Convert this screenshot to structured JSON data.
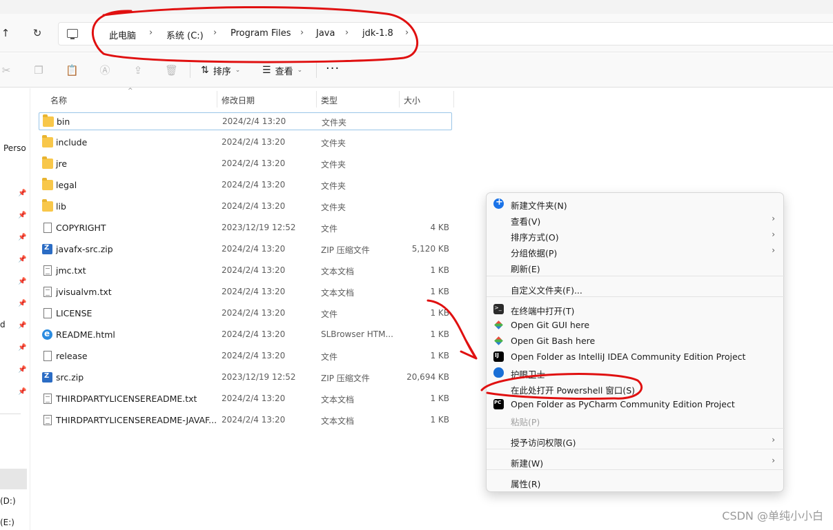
{
  "address_bar": {
    "crumbs": [
      "此电脑",
      "系统 (C:)",
      "Program Files",
      "Java",
      "jdk-1.8"
    ],
    "separator": "›"
  },
  "toolbar": {
    "sort_label": "排序",
    "view_label": "查看",
    "more_label": "···"
  },
  "sidebar": {
    "partial_labels": [
      "Perso",
      "d",
      "(D:)",
      "(E:)"
    ]
  },
  "file_list": {
    "columns": [
      "名称",
      "修改日期",
      "类型",
      "大小"
    ],
    "rows": [
      {
        "name": "bin",
        "date": "2024/2/4 13:20",
        "type": "文件夹",
        "size": "",
        "icon": "folder-icon"
      },
      {
        "name": "include",
        "date": "2024/2/4 13:20",
        "type": "文件夹",
        "size": "",
        "icon": "folder-icon"
      },
      {
        "name": "jre",
        "date": "2024/2/4 13:20",
        "type": "文件夹",
        "size": "",
        "icon": "folder-icon"
      },
      {
        "name": "legal",
        "date": "2024/2/4 13:20",
        "type": "文件夹",
        "size": "",
        "icon": "folder-icon"
      },
      {
        "name": "lib",
        "date": "2024/2/4 13:20",
        "type": "文件夹",
        "size": "",
        "icon": "folder-icon"
      },
      {
        "name": "COPYRIGHT",
        "date": "2023/12/19 12:52",
        "type": "文件",
        "size": "4 KB",
        "icon": "file-icon"
      },
      {
        "name": "javafx-src.zip",
        "date": "2024/2/4 13:20",
        "type": "ZIP 压缩文件",
        "size": "5,120 KB",
        "icon": "zip-icon"
      },
      {
        "name": "jmc.txt",
        "date": "2024/2/4 13:20",
        "type": "文本文档",
        "size": "1 KB",
        "icon": "text-file-icon"
      },
      {
        "name": "jvisualvm.txt",
        "date": "2024/2/4 13:20",
        "type": "文本文档",
        "size": "1 KB",
        "icon": "text-file-icon"
      },
      {
        "name": "LICENSE",
        "date": "2024/2/4 13:20",
        "type": "文件",
        "size": "1 KB",
        "icon": "file-icon"
      },
      {
        "name": "README.html",
        "date": "2024/2/4 13:20",
        "type": "SLBrowser HTM...",
        "size": "1 KB",
        "icon": "html-file-icon"
      },
      {
        "name": "release",
        "date": "2024/2/4 13:20",
        "type": "文件",
        "size": "1 KB",
        "icon": "file-icon"
      },
      {
        "name": "src.zip",
        "date": "2023/12/19 12:52",
        "type": "ZIP 压缩文件",
        "size": "20,694 KB",
        "icon": "zip-icon"
      },
      {
        "name": "THIRDPARTYLICENSEREADME.txt",
        "date": "2024/2/4 13:20",
        "type": "文本文档",
        "size": "1 KB",
        "icon": "text-file-icon"
      },
      {
        "name": "THIRDPARTYLICENSEREADME-JAVAF...",
        "date": "2024/2/4 13:20",
        "type": "文本文档",
        "size": "1 KB",
        "icon": "text-file-icon"
      }
    ]
  },
  "context_menu": {
    "items": [
      {
        "label": "新建文件夹(N)",
        "icon": "new-folder-icon"
      },
      {
        "label": "查看(V)",
        "submenu": true
      },
      {
        "label": "排序方式(O)",
        "submenu": true
      },
      {
        "label": "分组依据(P)",
        "submenu": true
      },
      {
        "label": "刷新(E)"
      },
      {
        "label": "自定义文件夹(F)..."
      },
      {
        "label": "在终端中打开(T)",
        "icon": "terminal-icon"
      },
      {
        "label": "Open Git GUI here",
        "icon": "git-icon"
      },
      {
        "label": "Open Git Bash here",
        "icon": "git-icon"
      },
      {
        "label": "Open Folder as IntelliJ IDEA Community Edition Project",
        "icon": "intellij-icon"
      },
      {
        "label": "护眼卫士",
        "icon": "shield-icon"
      },
      {
        "label": "在此处打开 Powershell 窗口(S)"
      },
      {
        "label": "Open Folder as PyCharm Community Edition Project",
        "icon": "pycharm-icon"
      },
      {
        "label": "粘贴(P)",
        "disabled": true
      },
      {
        "label": "授予访问权限(G)",
        "submenu": true
      },
      {
        "label": "新建(W)",
        "submenu": true
      },
      {
        "label": "属性(R)"
      }
    ]
  },
  "watermark": "CSDN @单纯小小白",
  "colors": {
    "annotation_red": "#e01010",
    "selection_border": "#99c5e8",
    "folder_yellow": "#f8c74a"
  }
}
